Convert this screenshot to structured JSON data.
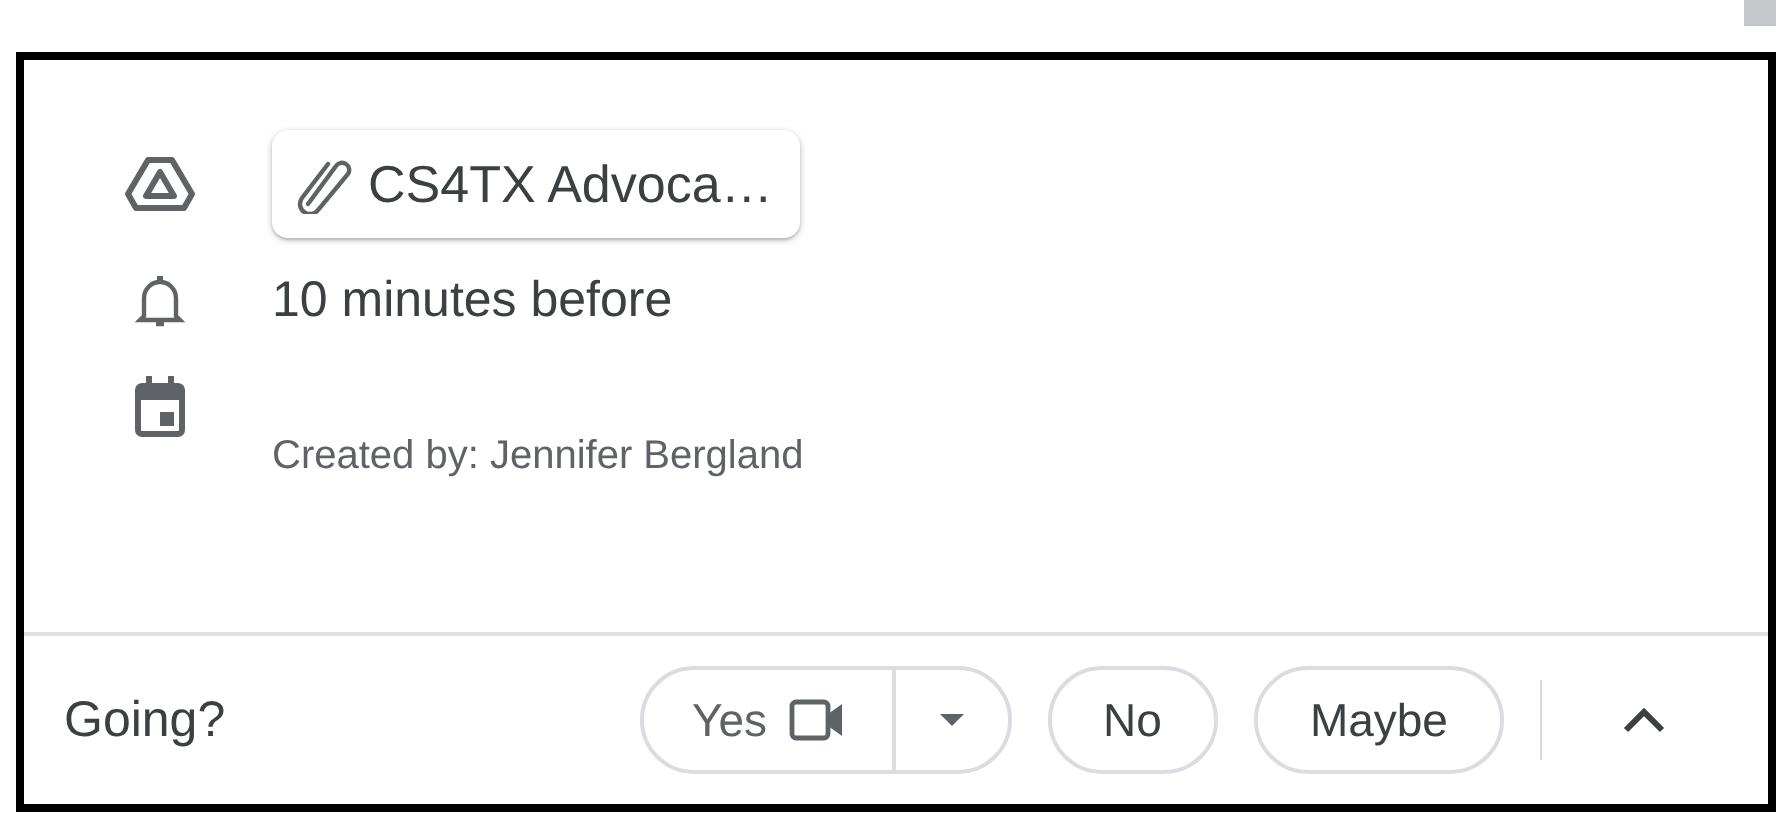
{
  "attachment": {
    "label": "CS4TX Advoca…"
  },
  "reminder": {
    "text": "10 minutes before"
  },
  "created_by": {
    "text": "Created by: Jennifer Bergland"
  },
  "footer": {
    "prompt": "Going?",
    "rsvp": [
      {
        "kind": "split",
        "label": "Yes",
        "selected": false
      },
      {
        "kind": "plain",
        "label": "No",
        "selected": false
      },
      {
        "kind": "plain",
        "label": "Maybe",
        "selected": false
      }
    ]
  }
}
